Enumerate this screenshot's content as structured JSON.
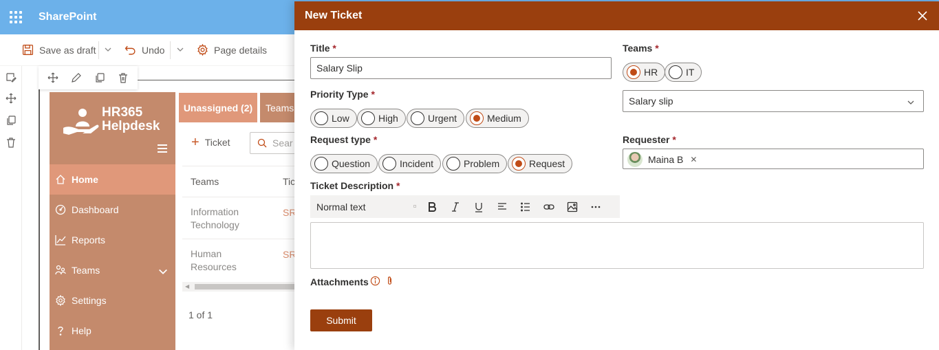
{
  "app": {
    "title": "SharePoint"
  },
  "command_bar": {
    "save_draft": "Save as draft",
    "undo": "Undo",
    "page_details": "Page details"
  },
  "helpdesk": {
    "logo_line1": "HR365",
    "logo_line2": "Helpdesk",
    "nav": [
      {
        "label": "Home",
        "icon": "home-icon"
      },
      {
        "label": "Dashboard",
        "icon": "dashboard-icon"
      },
      {
        "label": "Reports",
        "icon": "reports-icon"
      },
      {
        "label": "Teams",
        "icon": "teams-icon"
      },
      {
        "label": "Settings",
        "icon": "settings-icon"
      },
      {
        "label": "Help",
        "icon": "help-icon"
      }
    ],
    "tabs": {
      "unassigned": "Unassigned (2)",
      "teams": "Teams"
    },
    "add_ticket": "Ticket",
    "search_placeholder": "Sear",
    "columns": {
      "teams": "Teams",
      "ticket": "Tic"
    },
    "rows": [
      {
        "team": "Information Technology",
        "ticket": "SR-"
      },
      {
        "team": "Human Resources",
        "ticket": "SR-"
      }
    ],
    "pager": "1 of 1"
  },
  "panel": {
    "title": "New Ticket",
    "title_label": "Title",
    "title_value": "Salary Slip",
    "priority_label": "Priority Type",
    "priority_options": [
      "Low",
      "High",
      "Urgent",
      "Medium"
    ],
    "priority_selected": "Medium",
    "request_type_label": "Request type",
    "request_type_options": [
      "Question",
      "Incident",
      "Problem",
      "Request"
    ],
    "request_type_selected": "Request",
    "description_label": "Ticket Description",
    "rte_style": "Normal text",
    "attachments_label": "Attachments",
    "teams_label": "Teams",
    "teams_options": [
      "HR",
      "IT"
    ],
    "teams_selected": "HR",
    "category_value": "Salary slip",
    "requester_label": "Requester",
    "requester_name": "Maina B",
    "required_mark": "*",
    "submit_label": "Submit"
  },
  "colors": {
    "header": "#9a3f0e",
    "accent": "#c04b16",
    "nav_bg": "#c48a6c",
    "nav_active": "#e0987a",
    "sp_blue": "#6cb1ea"
  }
}
